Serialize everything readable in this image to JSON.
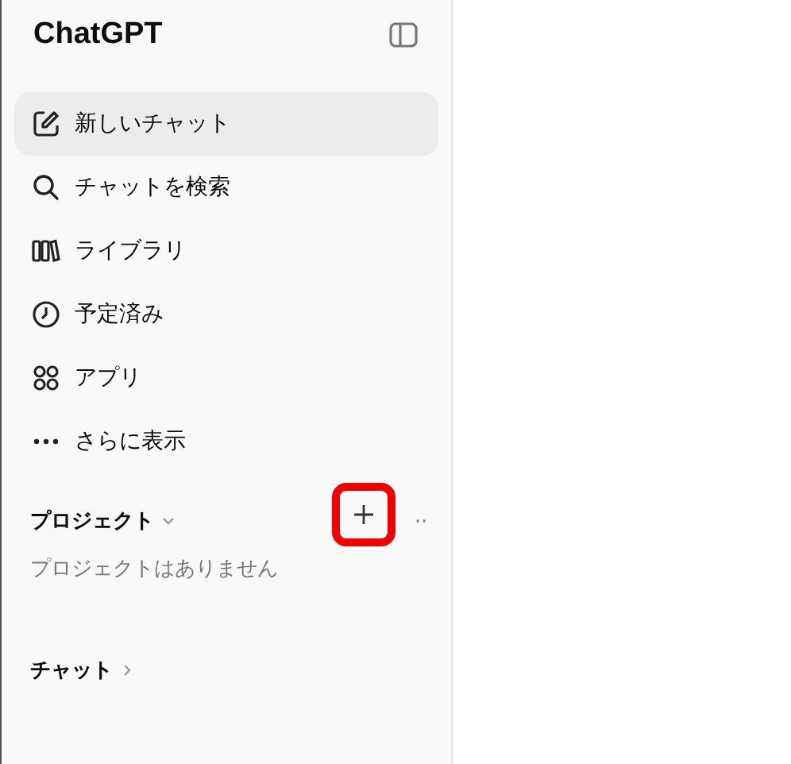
{
  "sidebar": {
    "title": "ChatGPT",
    "items": [
      {
        "kind": "new",
        "label": "新しいチャット",
        "selected": true
      },
      {
        "kind": "search",
        "label": "チャットを検索",
        "selected": false
      },
      {
        "kind": "library",
        "label": "ライブラリ",
        "selected": false
      },
      {
        "kind": "clock",
        "label": "予定済み",
        "selected": false
      },
      {
        "kind": "apps",
        "label": "アプリ",
        "selected": false
      },
      {
        "kind": "more",
        "label": "さらに表示",
        "selected": false
      }
    ],
    "projects": {
      "heading": "プロジェクト",
      "expanded": true,
      "empty_text": "プロジェクトはありません",
      "add_highlighted": true
    },
    "chats": {
      "heading": "チャット",
      "expanded": false
    }
  }
}
